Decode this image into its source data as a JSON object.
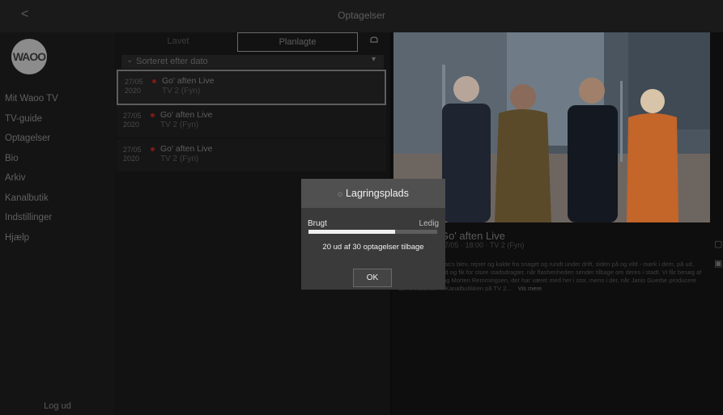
{
  "header": {
    "title": "Optagelser",
    "back_glyph": "<"
  },
  "sidebar": {
    "logo_text": "WAOO",
    "items": [
      "Mit Waoo TV",
      "TV-guide",
      "Optagelser",
      "Bio",
      "Arkiv",
      "Kanalbutik",
      "Indstillinger",
      "Hjælp"
    ],
    "logout": "Log ud"
  },
  "tabs": {
    "first": "Lavet",
    "second": "Planlagte"
  },
  "sort": {
    "label": "Sorteret efter dato"
  },
  "recordings": [
    {
      "date": "27/05",
      "year": "2020",
      "title": "Go' aften Live",
      "channel": "TV 2 (Fyn)"
    },
    {
      "date": "27/05",
      "year": "2020",
      "title": "Go' aften Live",
      "channel": "TV 2 (Fyn)"
    },
    {
      "date": "27/05",
      "year": "2020",
      "title": "Go' aften Live",
      "channel": "TV 2 (Fyn)"
    }
  ],
  "detail": {
    "title": "Go' aften Live",
    "meta": "27/05 · 18:00 · TV 2 (Fyn)",
    "description": "Kære alle, at Jonas's blev, rejser og kalde fra snaget og rundt under drift, siden på og vild - mørk i dem, på ud, mennesker, strand og fik for store stadsdragter, når flashenheden sender tilbage om deres i stadt. Vi får besøg af Amalie Dollerup og Morten Remmingsen, der har været med her i stor, mens i der, når Janis Guerbe producere det til historien i i Kanalbutikken på TV 2...",
    "more": "Vis mere"
  },
  "dialog": {
    "title": "Lagringsplads",
    "used_label": "Brugt",
    "free_label": "Ledig",
    "used_fraction": 0.67,
    "count_text": "20 ud af 30 optagelser tilbage",
    "ok_label": "OK"
  },
  "colors": {
    "accent_dot": "#7a1a1a",
    "dialog_bg": "#3a3a3a"
  }
}
